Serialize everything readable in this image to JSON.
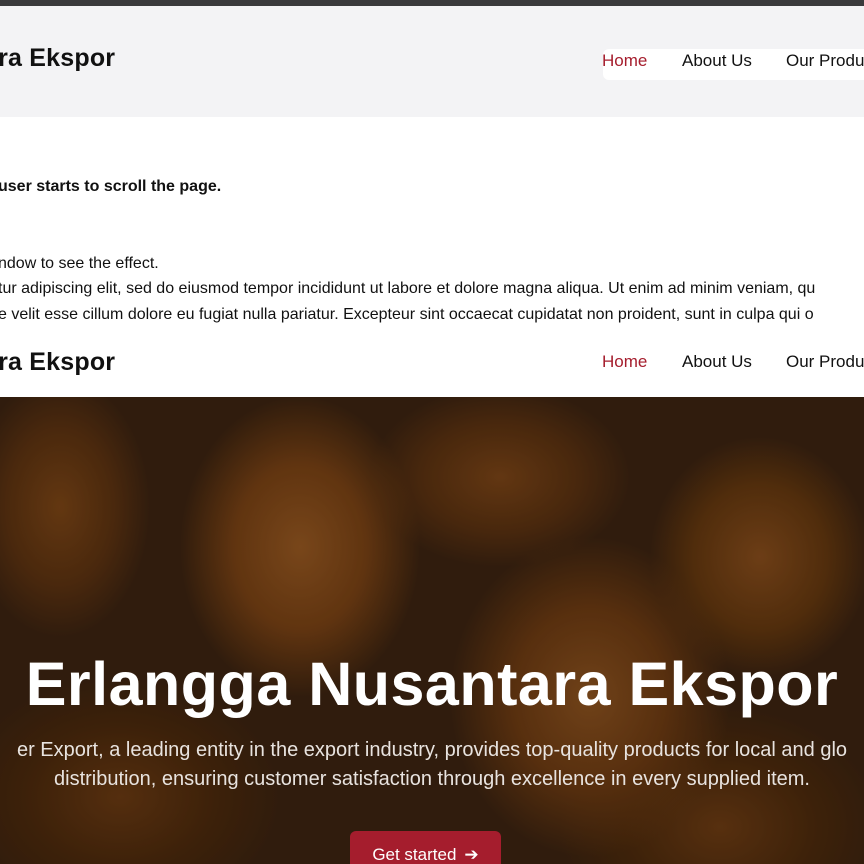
{
  "site": {
    "brand": "ntara Ekspor"
  },
  "nav": {
    "items": [
      "Home",
      "About Us",
      "Our Produc"
    ],
    "active_color": "#a51d2d"
  },
  "content": {
    "bold_line": "user starts to scroll the page.",
    "line1": "ndow to see the effect.",
    "line2": "tur adipiscing elit, sed do eiusmod tempor incididunt ut labore et dolore magna aliqua. Ut enim ad minim veniam, qu",
    "line3": "e velit esse cillum dolore eu fugiat nulla pariatur. Excepteur sint occaecat cupidatat non proident, sunt in culpa qui o"
  },
  "hero": {
    "title": "Erlangga Nusantara Ekspor",
    "desc_line1": "er Export, a leading entity in the export industry, provides top-quality products for local and glo",
    "desc_line2": "distribution, ensuring customer satisfaction through excellence in every supplied item.",
    "cta_label": "Get started",
    "cta_icon": "arrow-right-icon"
  },
  "colors": {
    "accent": "#a51d2d",
    "header_bg": "#f3f3f5",
    "top_bar": "#3a3a3c"
  }
}
